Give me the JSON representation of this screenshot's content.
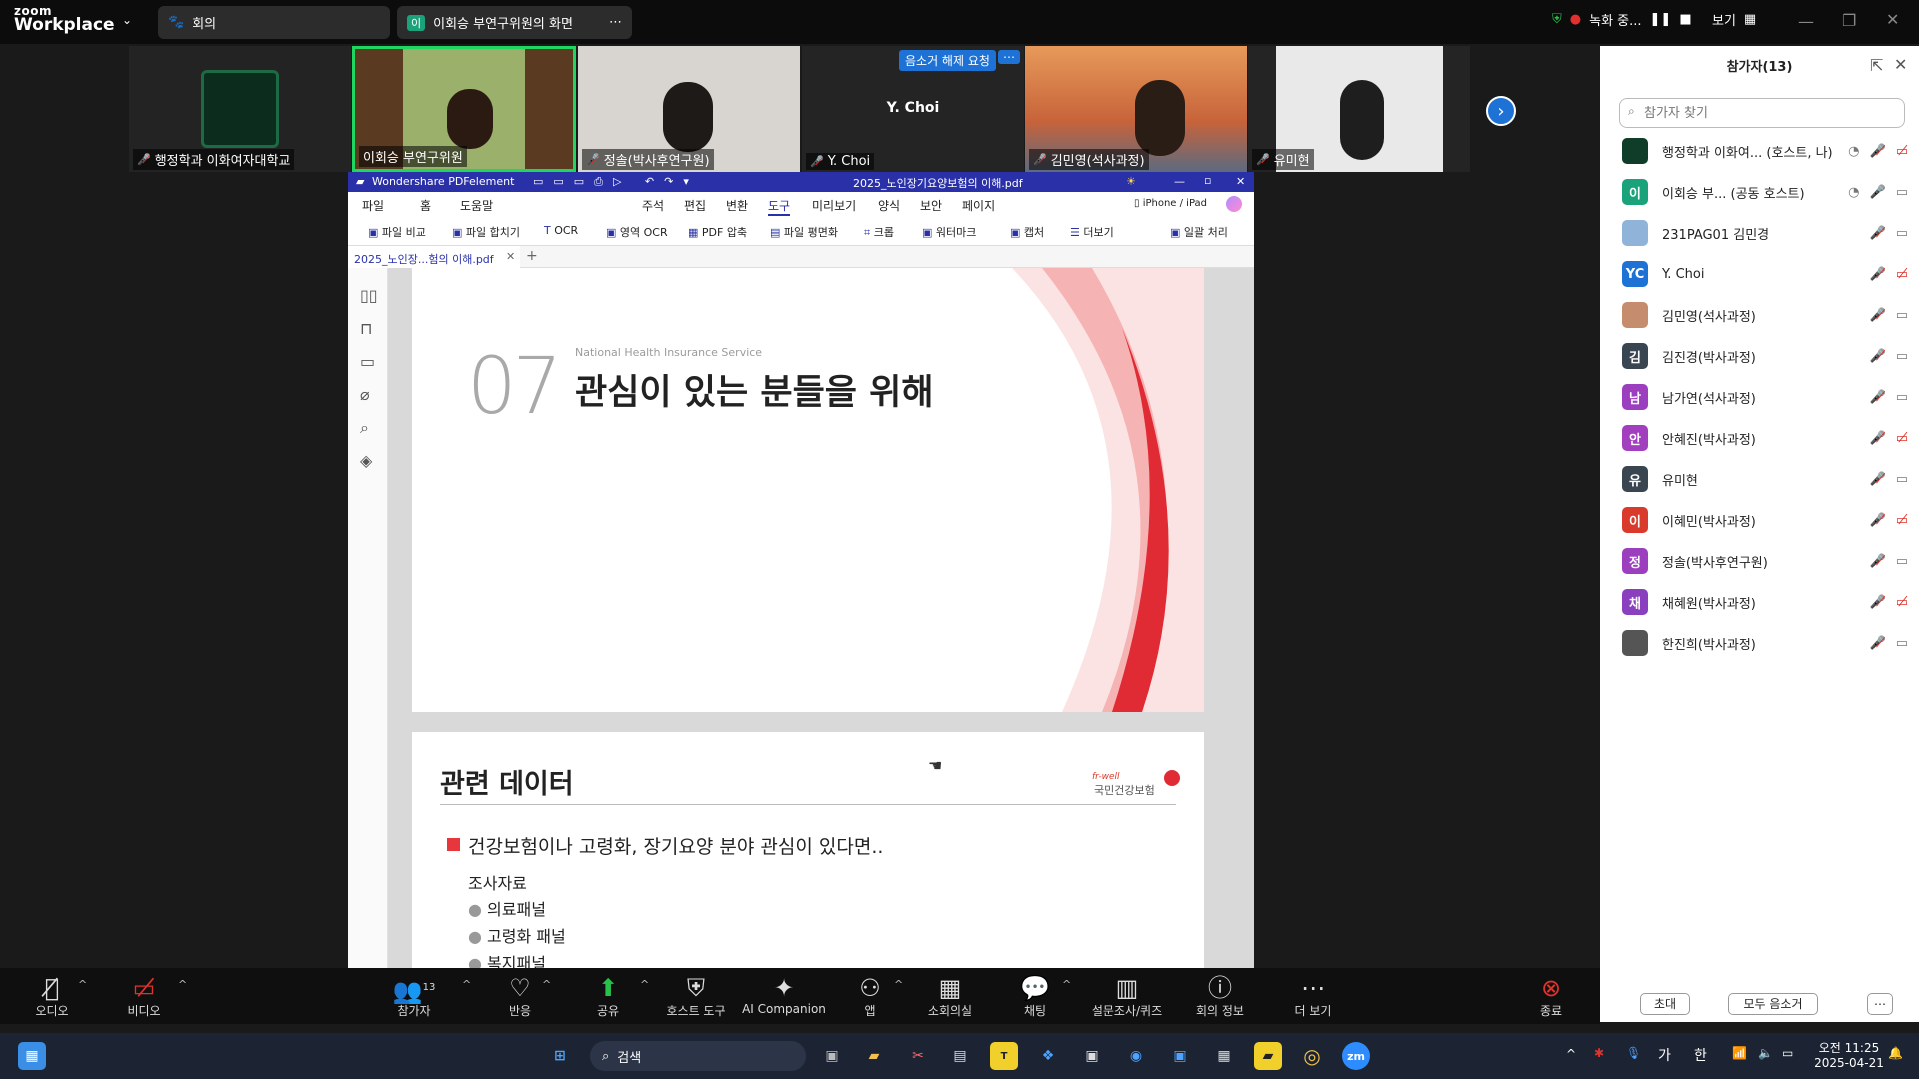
{
  "topbar": {
    "logo_top": "zoom",
    "logo_bottom": "Workplace",
    "tab1": "회의",
    "tab2_avatar": "이",
    "tab2": "이회승 부연구위원의 화면",
    "recording": "녹화 중...",
    "view": "보기"
  },
  "videos": [
    {
      "name": "행정학과 이화여자대학교"
    },
    {
      "name": "이회승 부연구위원"
    },
    {
      "name": "정솔(박사후연구원)"
    },
    {
      "name": "Y. Choi",
      "center": "Y. Choi",
      "badge": "음소거 해제 요청"
    },
    {
      "name": "김민영(석사과정)"
    },
    {
      "name": "유미현"
    }
  ],
  "sidebar": {
    "title": "참가자(13)",
    "search_placeholder": "참가자 찾기",
    "participants": [
      {
        "name": "행정학과 이화여... (호스트, 나)",
        "avatar": "",
        "color": "#0f3d2a"
      },
      {
        "name": "이회승 부... (공동 호스트)",
        "avatar": "이",
        "color": "#1aa37a"
      },
      {
        "name": "231PAG01 김민경",
        "avatar": "",
        "color": "#8fb3d9"
      },
      {
        "name": "Y. Choi",
        "avatar": "YC",
        "color": "#1e72d6"
      },
      {
        "name": "김민영(석사과정)",
        "avatar": "",
        "color": "#c58d6e"
      },
      {
        "name": "김진경(박사과정)",
        "avatar": "김",
        "color": "#3a4552"
      },
      {
        "name": "남가연(석사과정)",
        "avatar": "남",
        "color": "#9b3fbf"
      },
      {
        "name": "안혜진(박사과정)",
        "avatar": "안",
        "color": "#a23fbf"
      },
      {
        "name": "유미현",
        "avatar": "유",
        "color": "#3a4552"
      },
      {
        "name": "이혜민(박사과정)",
        "avatar": "이",
        "color": "#d93a2b"
      },
      {
        "name": "정솔(박사후연구원)",
        "avatar": "정",
        "color": "#9b3fbf"
      },
      {
        "name": "채혜원(박사과정)",
        "avatar": "채",
        "color": "#8a3fbf"
      },
      {
        "name": "한진희(박사과정)",
        "avatar": "",
        "color": "#555"
      }
    ],
    "invite": "초대",
    "mute_all": "모두 음소거"
  },
  "toolbar": {
    "audio": "오디오",
    "video": "비디오",
    "participants": "참가자",
    "participants_count": "13",
    "reactions": "반응",
    "share": "공유",
    "host_tools": "호스트 도구",
    "ai": "AI Companion",
    "apps": "앱",
    "breakout": "소회의실",
    "chat": "채팅",
    "polls": "설문조사/퀴즈",
    "info": "회의 정보",
    "more": "더 보기",
    "end": "종료"
  },
  "taskbar": {
    "search": "검색",
    "time": "오전 11:25",
    "date": "2025-04-21",
    "ime1": "가",
    "ime2": "한"
  },
  "pdf": {
    "app": "Wondershare PDFelement",
    "filename": "2025_노인장기요양보험의 이해.pdf",
    "menu_left": [
      "파일",
      "홈",
      "도움말"
    ],
    "menu": [
      "주석",
      "편집",
      "변환",
      "도구",
      "미리보기",
      "양식",
      "보안",
      "페이지"
    ],
    "device": "iPhone / iPad",
    "tools": [
      "파일 비교",
      "파일 합치기",
      "OCR",
      "영역 OCR",
      "PDF 압축",
      "파일 평면화",
      "크롭",
      "워터마크",
      "캡처",
      "더보기",
      "일괄 처리"
    ],
    "tab": "2025_노인장...험의 이해.pdf",
    "slide1": {
      "num": "07",
      "subtitle": "National Health Insurance Service",
      "title": "관심이 있는 분들을 위해"
    },
    "slide2": {
      "title": "관련 데이터",
      "logo_small": "fr-well",
      "logo": "국민건강보험",
      "bullet": "건강보험이나 고령화, 장기요양 분야 관심이 있다면..",
      "sub": "조사자료",
      "items": [
        "의료패널",
        "고령화 패널",
        "복지패널"
      ]
    }
  }
}
